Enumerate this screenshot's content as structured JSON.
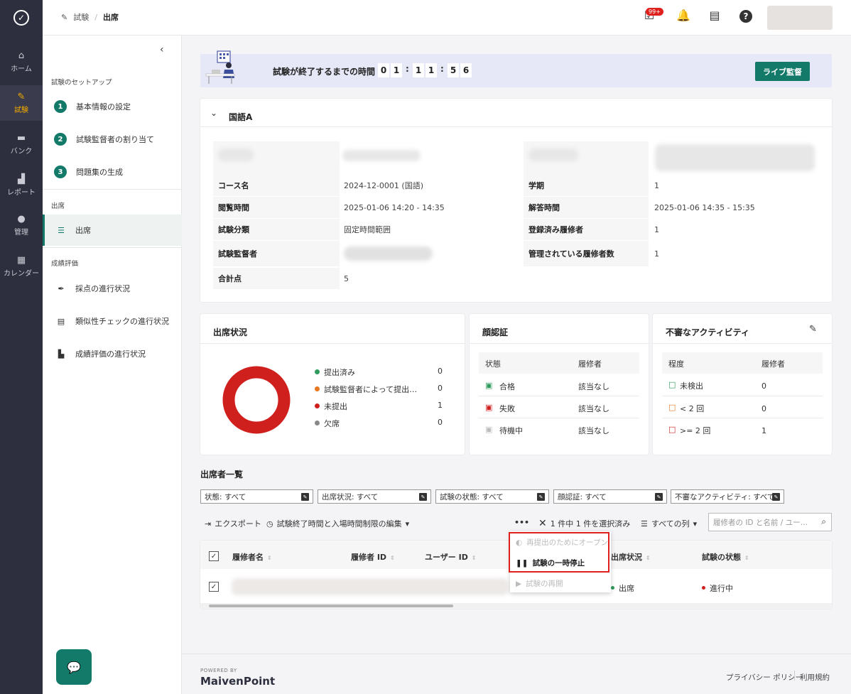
{
  "nav": {
    "items": [
      {
        "label": "ホーム"
      },
      {
        "label": "試験"
      },
      {
        "label": "バンク"
      },
      {
        "label": "レポート"
      },
      {
        "label": "管理"
      },
      {
        "label": "カレンダー"
      }
    ]
  },
  "header": {
    "breadcrumb": [
      "試験",
      "出席"
    ],
    "notification_badge": "99+"
  },
  "sidebar": {
    "setup_heading": "試験のセットアップ",
    "steps": [
      {
        "num": "1",
        "label": "基本情報の設定"
      },
      {
        "num": "2",
        "label": "試験監督者の割り当て"
      },
      {
        "num": "3",
        "label": "問題集の生成"
      }
    ],
    "attendance_heading": "出席",
    "attendance_item": "出席",
    "grading_heading": "成績評価",
    "grading_items": [
      {
        "label": "採点の進行状況"
      },
      {
        "label": "類似性チェックの進行状況"
      },
      {
        "label": "成績評価の進行状況"
      }
    ]
  },
  "banner": {
    "label": "試験が終了するまでの時間",
    "digits": [
      "0",
      "1",
      "1",
      "1",
      "5",
      "6"
    ],
    "live_button": "ライブ監督"
  },
  "info": {
    "title": "国語A",
    "left": [
      {
        "label": "コース名",
        "value": "2024-12-0001 (国語)"
      },
      {
        "label": "閲覧時間",
        "value": "2025-01-06 14:20 - 14:35"
      },
      {
        "label": "試験分類",
        "value": "固定時間範囲"
      },
      {
        "label": "試験監督者",
        "value": ""
      },
      {
        "label": "合計点",
        "value": "5"
      }
    ],
    "right": [
      {
        "label": "学期",
        "value": "1"
      },
      {
        "label": "解答時間",
        "value": "2025-01-06 14:35 - 15:35"
      },
      {
        "label": "登録済み履修者",
        "value": "1"
      },
      {
        "label": "管理されている履修者数",
        "value": "1"
      }
    ]
  },
  "attendance_status": {
    "title": "出席状況",
    "legend": [
      {
        "label": "提出済み",
        "value": "0",
        "color": "#2e9a5b"
      },
      {
        "label": "試験監督者によって提出…",
        "value": "0",
        "color": "#e87722"
      },
      {
        "label": "未提出",
        "value": "1",
        "color": "#d0201d"
      },
      {
        "label": "欠席",
        "value": "0",
        "color": "#888888"
      }
    ]
  },
  "face_auth": {
    "title": "顔認証",
    "headers": [
      "状態",
      "履修者"
    ],
    "rows": [
      {
        "status": "合格",
        "value": "該当なし",
        "color": "#2e9a5b"
      },
      {
        "status": "失敗",
        "value": "該当なし",
        "color": "#d0201d"
      },
      {
        "status": "待機中",
        "value": "該当なし",
        "color": "#aaaaaa"
      }
    ]
  },
  "suspicious": {
    "title": "不審なアクティビティ",
    "headers": [
      "程度",
      "履修者"
    ],
    "rows": [
      {
        "level": "未検出",
        "value": "0",
        "color": "#2e9a5b"
      },
      {
        "level": "< 2 回",
        "value": "0",
        "color": "#e87722"
      },
      {
        "level": ">= 2 回",
        "value": "1",
        "color": "#d0201d"
      }
    ]
  },
  "list": {
    "title": "出席者一覧",
    "filters": [
      {
        "label": "状態: すべて"
      },
      {
        "label": "出席状況: すべて"
      },
      {
        "label": "試験の状態: すべて"
      },
      {
        "label": "顔認証: すべて"
      },
      {
        "label": "不審なアクティビティ: すべて"
      }
    ],
    "export": "エクスポート",
    "edit_time": "試験終了時間と入場時間制限の編集",
    "more": "•••",
    "selected": "1 件中 1 件を選択済み",
    "columns_btn": "すべての列",
    "search_placeholder": "履修者の ID と名前 / ユー…",
    "columns": [
      "履修者名",
      "履修者 ID",
      "ユーザー ID",
      "出席状況",
      "試験の状態"
    ],
    "row": {
      "attendance": "出席",
      "exam_status": "進行中"
    }
  },
  "dropdown": {
    "items": [
      "再提出のためにオープン",
      "試験の一時停止",
      "試験の再開"
    ]
  },
  "footer": {
    "powered_by": "POWERED BY",
    "brand": "MaivenPoint",
    "privacy": "プライバシー ポリシー",
    "terms": "利用規約"
  }
}
